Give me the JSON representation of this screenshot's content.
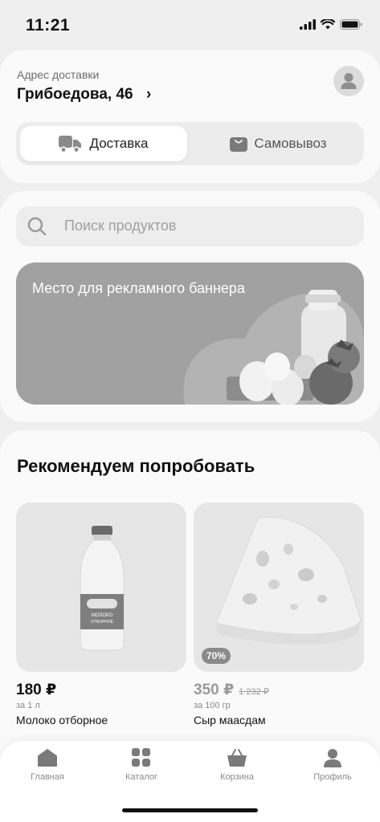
{
  "status": {
    "time": "11:21"
  },
  "address": {
    "label": "Адрес доставки",
    "value": "Грибоедова, 46",
    "chevron": "›"
  },
  "delivery_toggle": {
    "options": [
      {
        "label": "Доставка",
        "icon": "truck-icon",
        "active": true
      },
      {
        "label": "Самовывоз",
        "icon": "bag-icon",
        "active": false
      }
    ]
  },
  "search": {
    "placeholder": "Поиск продуктов"
  },
  "banner": {
    "text": "Место для рекламного баннера"
  },
  "recommend": {
    "title": "Рекомендуем попробовать",
    "products": [
      {
        "price": "180 ₽",
        "old_price": "",
        "unit": "за 1 л",
        "name": "Молоко отборное",
        "badge": ""
      },
      {
        "price": "350 ₽",
        "old_price": "1 232 ₽",
        "unit": "за 100 гр",
        "name": "Сыр маасдам",
        "badge": "70%"
      }
    ]
  },
  "tabbar": {
    "items": [
      {
        "label": "Главная",
        "icon": "home-icon"
      },
      {
        "label": "Каталог",
        "icon": "catalog-icon"
      },
      {
        "label": "Корзина",
        "icon": "basket-icon"
      },
      {
        "label": "Профиль",
        "icon": "profile-icon"
      }
    ]
  },
  "colors": {
    "accent": "#111111",
    "muted": "#8a8a8a",
    "banner": "#a1a1a1",
    "surface": "#fafafa",
    "background": "#efefef"
  }
}
